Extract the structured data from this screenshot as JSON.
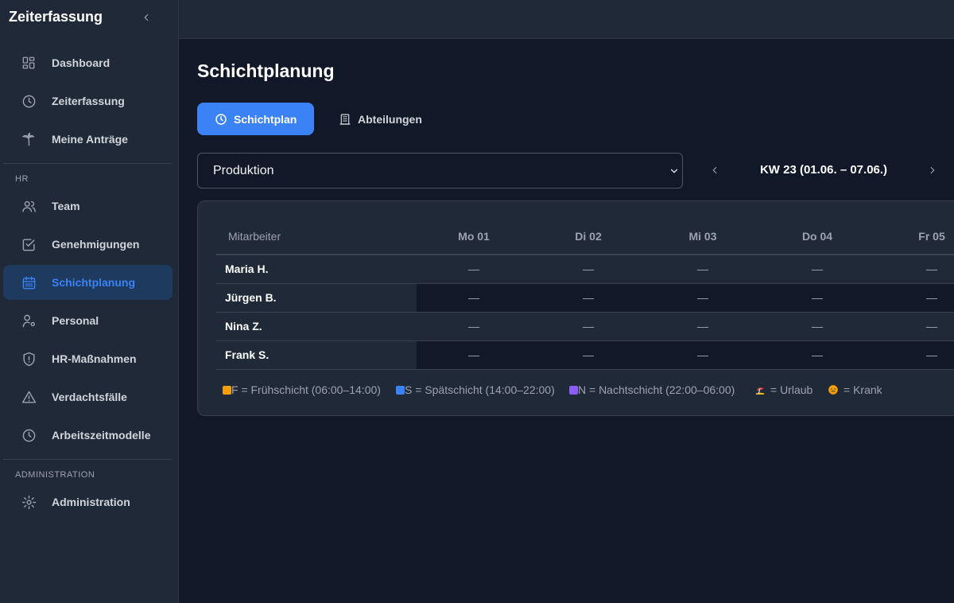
{
  "sidebar": {
    "brand": "Zeiterfassung",
    "items_main": [
      {
        "label": "Dashboard",
        "icon": "grid-icon"
      },
      {
        "label": "Zeiterfassung",
        "icon": "clock-icon"
      },
      {
        "label": "Meine Anträge",
        "icon": "palm-tree-icon"
      }
    ],
    "section_hr": "HR",
    "items_hr": [
      {
        "label": "Team",
        "icon": "users-icon"
      },
      {
        "label": "Genehmigungen",
        "icon": "check-square-icon"
      },
      {
        "label": "Schichtplanung",
        "icon": "calendar-icon"
      },
      {
        "label": "Personal",
        "icon": "user-cog-icon"
      },
      {
        "label": "HR-Maßnahmen",
        "icon": "shield-alert-icon"
      },
      {
        "label": "Verdachtsfälle",
        "icon": "warning-triangle-icon"
      },
      {
        "label": "Arbeitszeitmodelle",
        "icon": "clock-icon"
      }
    ],
    "section_admin": "ADMINISTRATION",
    "items_admin": [
      {
        "label": "Administration",
        "icon": "gear-icon"
      }
    ],
    "active_item": "Schichtplanung"
  },
  "main": {
    "title": "Schichtplanung",
    "tabs": [
      {
        "label": "Schichtplan",
        "active": true
      },
      {
        "label": "Abteilungen",
        "active": false
      }
    ],
    "department_select": "Produktion",
    "week_label": "KW 23 (01.06. – 07.06.)",
    "table": {
      "header_employee": "Mitarbeiter",
      "days": [
        "Mo 01",
        "Di 02",
        "Mi 03",
        "Do 04",
        "Fr 05"
      ],
      "rows": [
        {
          "name": "Maria H.",
          "cells": [
            "—",
            "—",
            "—",
            "—",
            "—"
          ]
        },
        {
          "name": "Jürgen B.",
          "cells": [
            "—",
            "—",
            "—",
            "—",
            "—"
          ]
        },
        {
          "name": "Nina Z.",
          "cells": [
            "—",
            "—",
            "—",
            "—",
            "—"
          ]
        },
        {
          "name": "Frank S.",
          "cells": [
            "—",
            "—",
            "—",
            "—",
            "—"
          ]
        }
      ]
    },
    "legend": [
      {
        "text": "F = Frühschicht (06:00–14:00)",
        "color": "#f59e0b"
      },
      {
        "text": "S = Spätschicht (14:00–22:00)",
        "color": "#3b82f6"
      },
      {
        "text": "N = Nachtschicht (22:00–06:00)",
        "color": "#8b5cf6"
      },
      {
        "text": "= Urlaub",
        "icon": "beach-icon"
      },
      {
        "text": "= Krank",
        "icon": "sick-face-icon"
      }
    ]
  },
  "colors": {
    "accent": "#3b82f6",
    "background": "#111827",
    "sidebar": "#1f2937"
  }
}
